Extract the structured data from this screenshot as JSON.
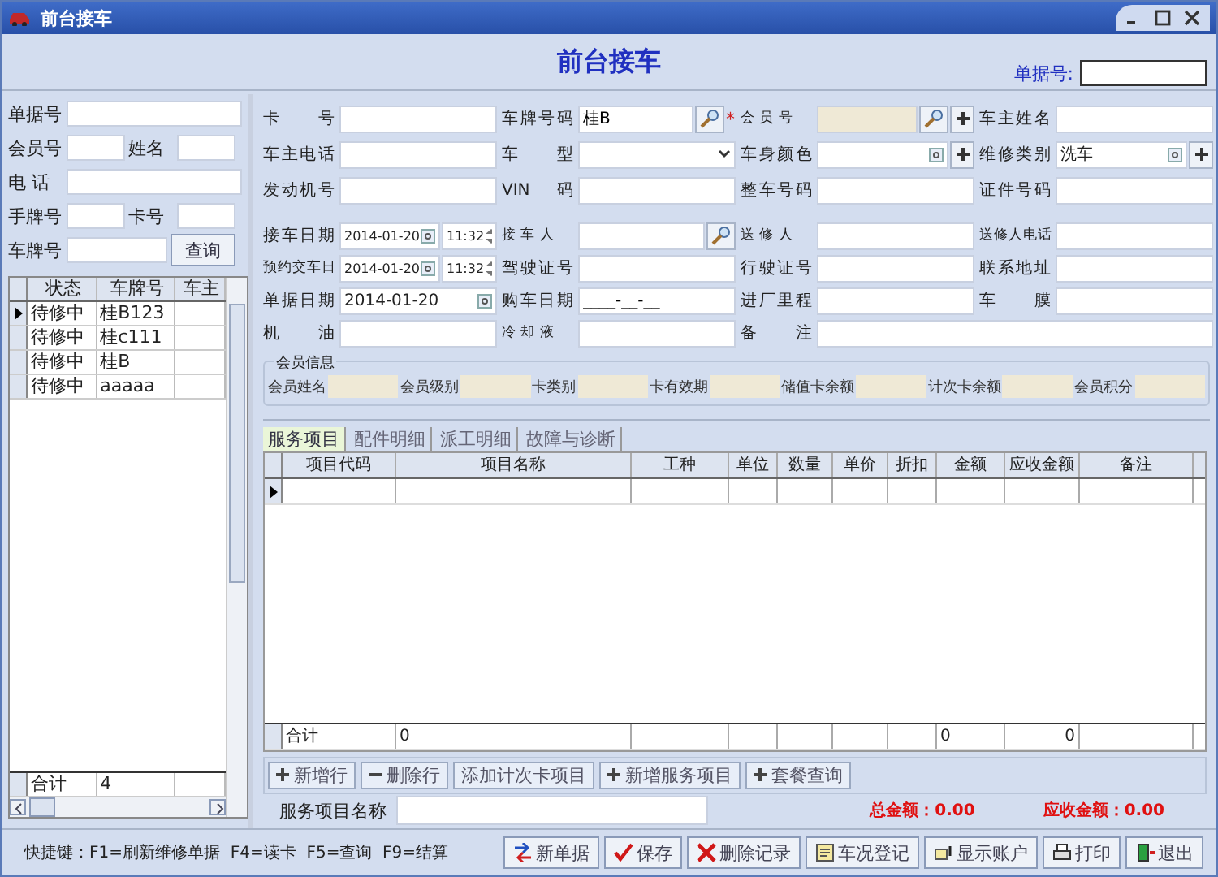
{
  "window": {
    "title": "前台接车"
  },
  "header": {
    "title": "前台接车",
    "doc_no_label": "单据号:"
  },
  "search": {
    "rows": [
      [
        {
          "label": "单据号",
          "kind": "wide"
        }
      ],
      [
        {
          "label": "会员号",
          "kind": "half"
        },
        {
          "label": "姓名",
          "kind": "half"
        }
      ],
      [
        {
          "label": "电 话",
          "kind": "wide"
        }
      ],
      [
        {
          "label": "手牌号",
          "kind": "half"
        },
        {
          "label": "卡号",
          "kind": "half"
        }
      ],
      [
        {
          "label": "车牌号",
          "kind": "mid"
        }
      ]
    ],
    "button": "查询"
  },
  "vehicles": {
    "columns": [
      "状态",
      "车牌号",
      "车主"
    ],
    "rows": [
      {
        "status": "待修中",
        "plate": "桂B123",
        "selected": true
      },
      {
        "status": "待修中",
        "plate": "桂c111",
        "selected": false
      },
      {
        "status": "待修中",
        "plate": "桂B",
        "selected": false
      },
      {
        "status": "待修中",
        "plate": "aaaaa",
        "selected": false
      }
    ],
    "total_label": "合计",
    "total": "4"
  },
  "form": {
    "rows": [
      [
        {
          "label": "卡 号",
          "kind": "text"
        },
        {
          "label": "车牌号码",
          "kind": "lookup",
          "value": "桂B",
          "required_mark": "*"
        },
        {
          "label": "会 员 号",
          "kind": "lookup",
          "readonly": true,
          "add": true
        },
        {
          "label": "车主姓名",
          "kind": "text"
        }
      ],
      [
        {
          "label": "车主电话",
          "kind": "text"
        },
        {
          "label": "车 型",
          "kind": "combo"
        },
        {
          "label": "车身颜色",
          "kind": "spin",
          "add": true
        },
        {
          "label": "维修类别",
          "kind": "spin",
          "value": "洗车",
          "add": true
        }
      ],
      [
        {
          "label": "发动机号",
          "kind": "text"
        },
        {
          "label": "VIN码",
          "kind": "text"
        },
        {
          "label": "整车号码",
          "kind": "text"
        },
        {
          "label": "证件号码",
          "kind": "text"
        }
      ]
    ],
    "rows2": [
      [
        {
          "label": "接车日期",
          "kind": "datetime",
          "value": "2014-01-20",
          "time": "11:32"
        },
        {
          "label": "接 车 人",
          "kind": "lookup"
        },
        {
          "label": "送 修 人",
          "kind": "text"
        },
        {
          "label": "送修人电话",
          "kind": "text"
        }
      ],
      [
        {
          "label": "预约交车日",
          "kind": "datetime",
          "value": "2014-01-20",
          "time": "11:32"
        },
        {
          "label": "驾驶证号",
          "kind": "text"
        },
        {
          "label": "行驶证号",
          "kind": "text"
        },
        {
          "label": "联系地址",
          "kind": "text"
        }
      ],
      [
        {
          "label": "单据日期",
          "kind": "date",
          "value": "2014-01-20"
        },
        {
          "label": "购车日期",
          "kind": "text",
          "value": "____-__-__"
        },
        {
          "label": "进厂里程",
          "kind": "text"
        },
        {
          "label": "车 膜",
          "kind": "text"
        }
      ],
      [
        {
          "label": "机 油",
          "kind": "text"
        },
        {
          "label": "冷 却 液",
          "kind": "text"
        },
        {
          "label": "备 注",
          "kind": "text",
          "wide": true
        }
      ]
    ]
  },
  "member_info": {
    "title": "会员信息",
    "fields": [
      "会员姓名",
      "会员级别",
      "卡类别",
      "卡有效期",
      "储值卡余额",
      "计次卡余额",
      "会员积分"
    ]
  },
  "grid_tabs": [
    {
      "label": "服务项目",
      "selected": true
    },
    {
      "label": "配件明细",
      "selected": false
    },
    {
      "label": "派工明细",
      "selected": false
    },
    {
      "label": "故障与诊断",
      "selected": false
    }
  ],
  "grid": {
    "columns": [
      "项目代码",
      "项目名称",
      "工种",
      "单位",
      "数量",
      "单价",
      "折扣",
      "金额",
      "应收金额",
      "备注"
    ],
    "footer": {
      "label": "合计",
      "count": "0",
      "amount": "0",
      "receivable": "0"
    }
  },
  "grid_buttons": [
    {
      "label": "新增行",
      "kind": "plus"
    },
    {
      "label": "删除行",
      "kind": "minus"
    },
    {
      "label": "添加计次卡项目",
      "kind": "plain"
    },
    {
      "label": "新增服务项目",
      "kind": "plus"
    },
    {
      "label": "套餐查询",
      "kind": "plus"
    }
  ],
  "service_name_label": "服务项目名称",
  "totals": [
    {
      "label": "总金额：",
      "value": "0.00"
    },
    {
      "label": "应收金额：",
      "value": "0.00"
    }
  ],
  "shortcuts": "快捷键：F1=刷新维修单据  F4=读卡  F5=查询  F9=结算",
  "actions": [
    {
      "label": "新单据",
      "kind": "new"
    },
    {
      "label": "保存",
      "kind": "save"
    },
    {
      "label": "删除记录",
      "kind": "delete"
    },
    {
      "label": "车况登记",
      "kind": "register"
    },
    {
      "label": "显示账户",
      "kind": "account"
    },
    {
      "label": "打印",
      "kind": "print"
    },
    {
      "label": "退出",
      "kind": "exit"
    }
  ]
}
